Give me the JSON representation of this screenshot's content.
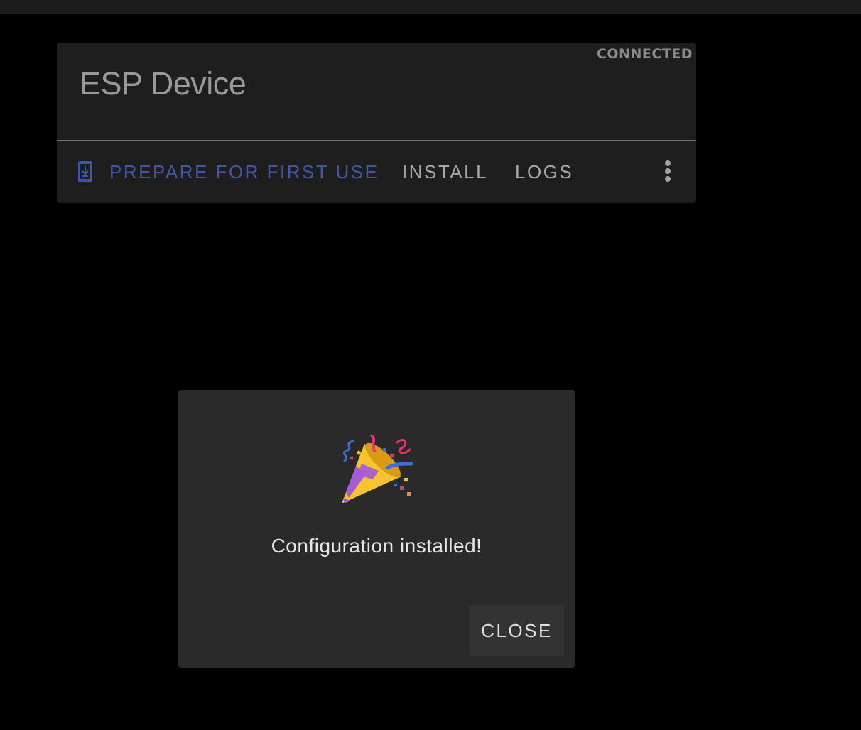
{
  "device": {
    "name": "ESP Device",
    "status": "CONNECTED"
  },
  "actions": {
    "prepare_label": "PREPARE FOR FIRST USE",
    "install_label": "INSTALL",
    "logs_label": "LOGS",
    "prepare_icon": "download-to-device-icon",
    "more_icon": "more-vert-icon"
  },
  "dialog": {
    "icon": "party-popper-icon",
    "message": "Configuration installed!",
    "close_label": "CLOSE"
  },
  "colors": {
    "background": "#000000",
    "card": "#1e1e1e",
    "accent": "#4057a8",
    "dialog": "#2a2a2a"
  }
}
